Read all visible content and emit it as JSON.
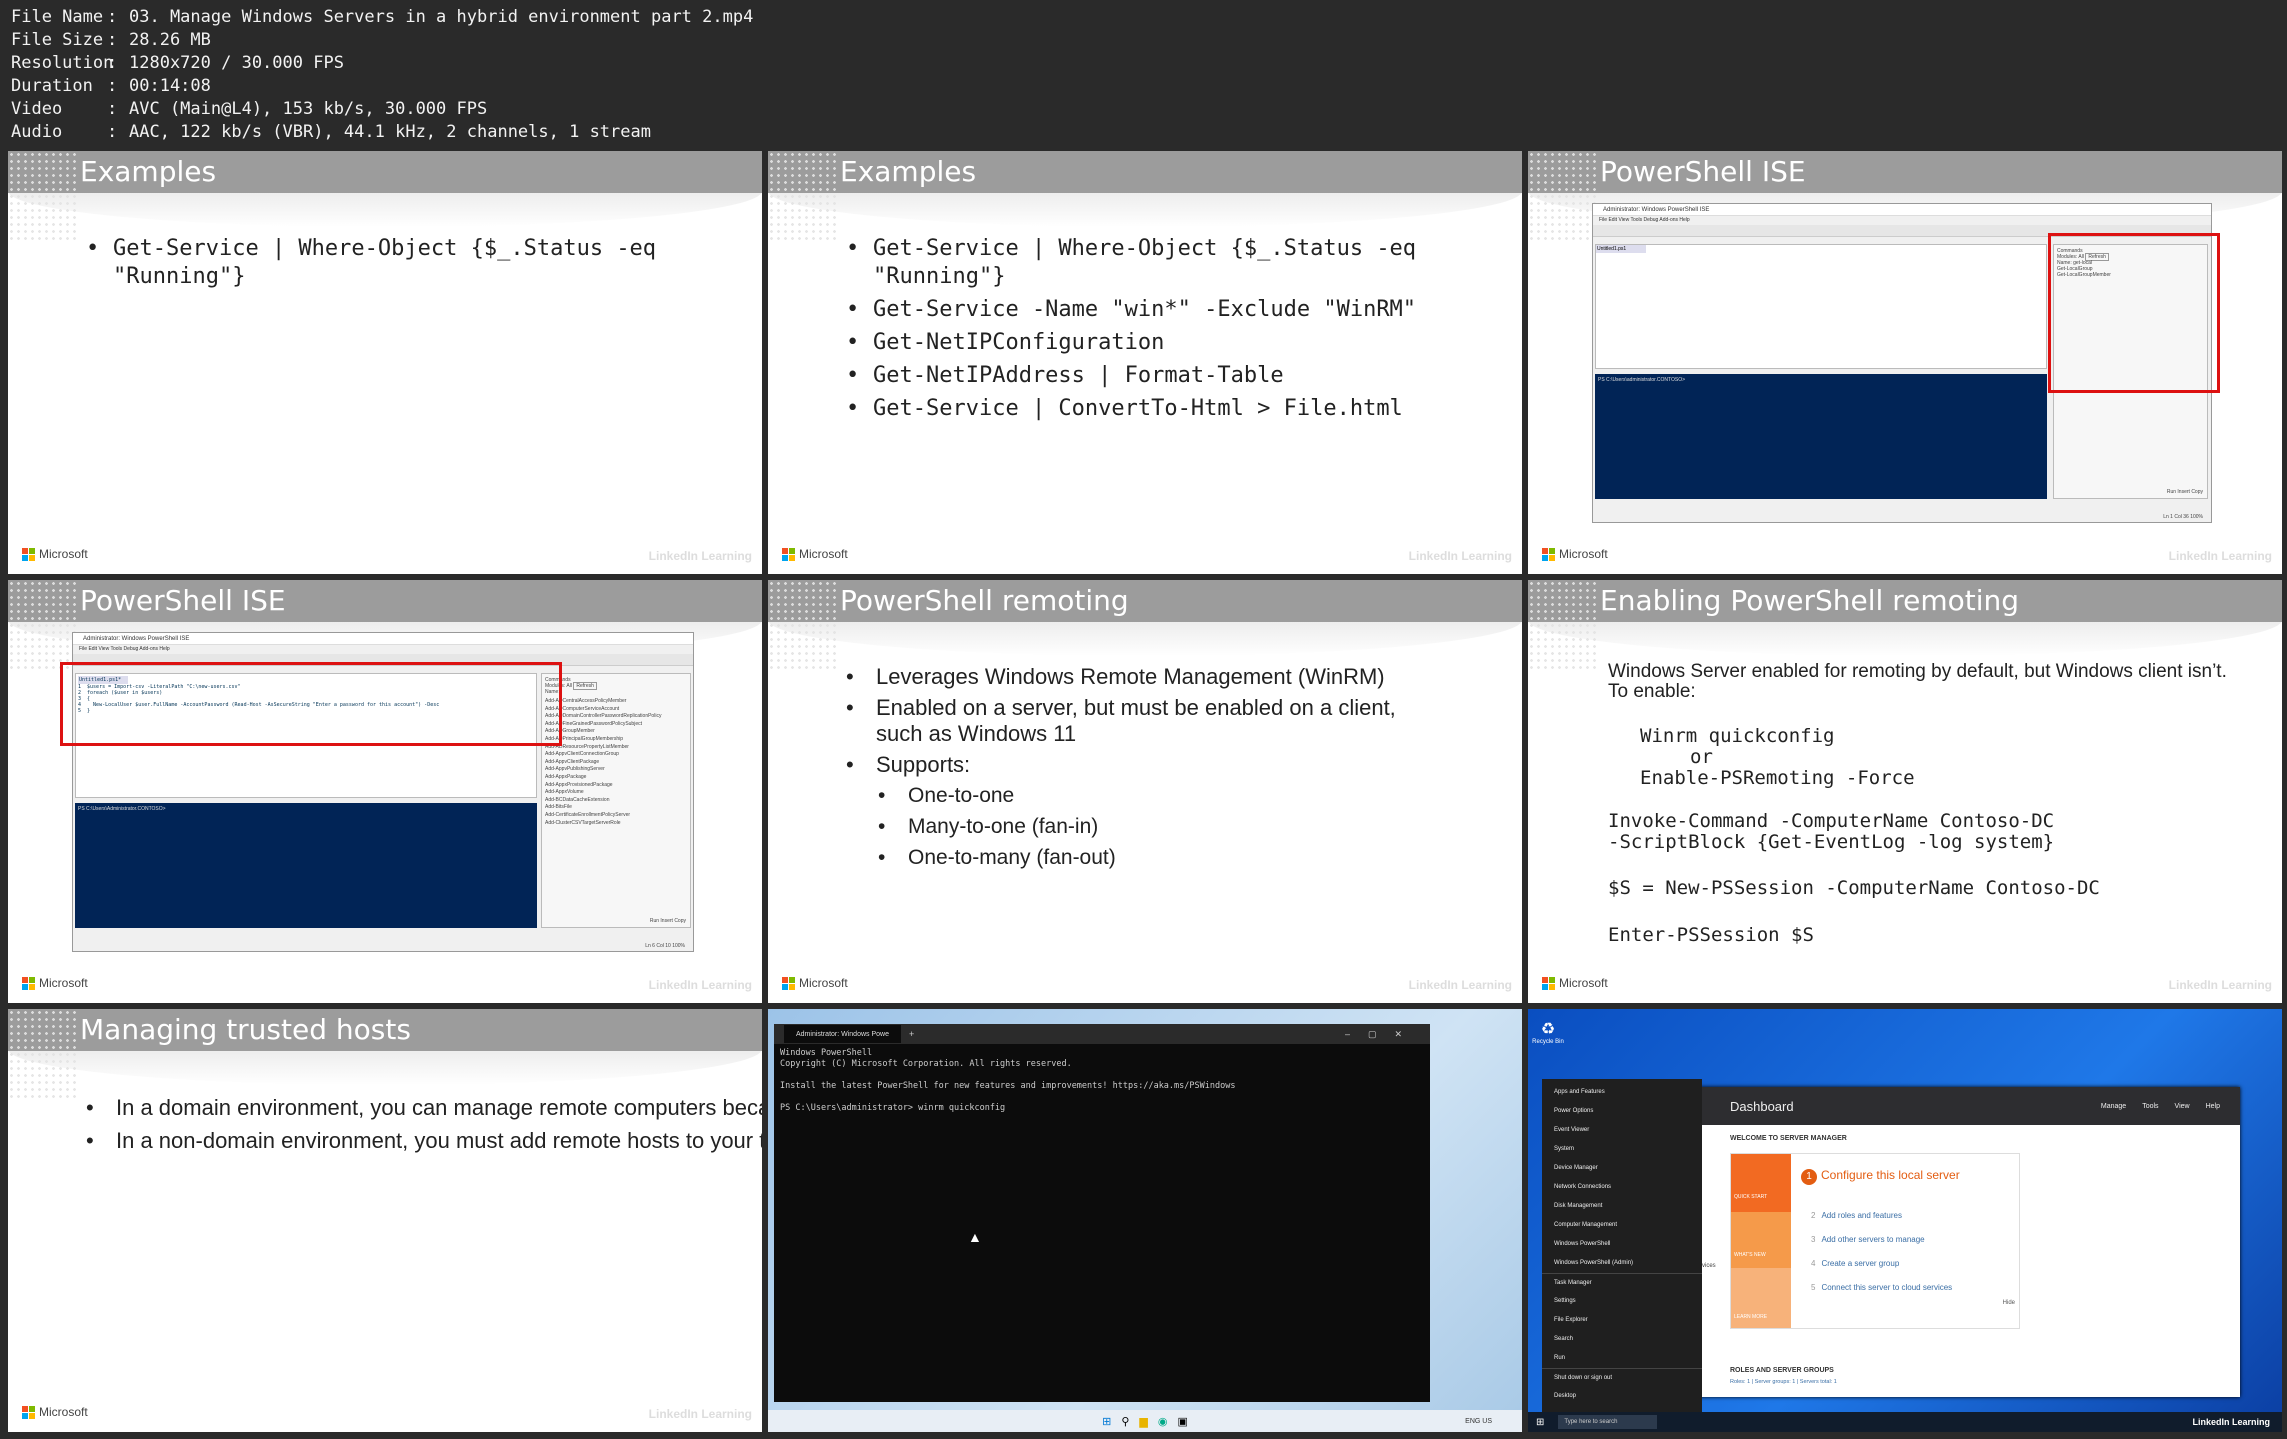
{
  "file_info": [
    {
      "key": "File Name",
      "value": "03. Manage Windows Servers in a hybrid environment part 2.mp4"
    },
    {
      "key": "File Size",
      "value": "28.26 MB"
    },
    {
      "key": "Resolution",
      "value": "1280x720 / 30.000 FPS"
    },
    {
      "key": "Duration",
      "value": "00:14:08"
    },
    {
      "key": "Video",
      "value": "AVC (Main@L4), 153 kb/s, 30.000 FPS"
    },
    {
      "key": "Audio",
      "value": "AAC, 122 kb/s (VBR), 44.1 kHz, 2 channels, 1 stream"
    }
  ],
  "brand": "Microsoft",
  "watermark": "LinkedIn Learning",
  "slides": {
    "s1": {
      "title": "Examples",
      "items": [
        "Get-Service | Where-Object {$_.Status -eq\n\"Running\"}"
      ]
    },
    "s2": {
      "title": "Examples",
      "items": [
        "Get-Service | Where-Object {$_.Status -eq\n\"Running\"}",
        "Get-Service -Name \"win*\" -Exclude \"WinRM\"",
        "Get-NetIPConfiguration",
        "Get-NetIPAddress | Format-Table",
        "Get-Service | ConvertTo-Html > File.html"
      ]
    },
    "s3": {
      "title": "PowerShell ISE",
      "window_title": "Administrator: Windows PowerShell ISE",
      "menu": "File  Edit  View  Tools  Debug  Add-ons  Help",
      "tab": "Untitled1.ps1",
      "prompt": "PS C:\\Users\\administrator.CONTOSO>",
      "commands_tab": "Commands",
      "modules_label": "Modules:",
      "modules_value": "All",
      "name_label": "Name:",
      "name_value": "get-local",
      "refresh": "Refresh",
      "cmd1": "Get-LocalGroup",
      "cmd2": "Get-LocalGroupMember",
      "status": "Ln 1  Col 36",
      "zoom": "100%",
      "buttons": [
        "Run",
        "Insert",
        "Copy"
      ]
    },
    "s4": {
      "title": "PowerShell ISE",
      "window_title": "Administrator: Windows PowerShell ISE",
      "menu": "File  Edit  View  Tools  Debug  Add-ons  Help",
      "tab": "Untitled1.ps1*",
      "code": [
        "1  $users = Import-csv -LiteralPath \"C:\\new-users.csv\"",
        "2  foreach ($user in $users)",
        "3  {",
        "4    New-LocalUser $user.FullName -AccountPassword (Read-Host -AsSecureString \"Enter a password for this account\") -Desc",
        "5  }"
      ],
      "prompt": "PS C:\\Users\\Administrator.CONTOSO>",
      "commands_tab": "Commands",
      "modules_label": "Modules:",
      "modules_value": "All",
      "name_label": "Name:",
      "refresh": "Refresh",
      "cmd_list": [
        "Add-ADCentralAccessPolicyMember",
        "Add-ADComputerServiceAccount",
        "Add-ADDomainControllerPasswordReplicationPolicy",
        "Add-ADFineGrainedPasswordPolicySubject",
        "Add-ADGroupMember",
        "Add-ADPrincipalGroupMembership",
        "Add-ADResourcePropertyListMember",
        "Add-AppvClientConnectionGroup",
        "Add-AppvClientPackage",
        "Add-AppvPublishingServer",
        "Add-AppxPackage",
        "Add-AppxProvisionedPackage",
        "Add-AppxVolume",
        "Add-BCDataCacheExtension",
        "Add-BitsFile",
        "Add-CertificateEnrollmentPolicyServer",
        "Add-ClusterCSVTargetServerRole"
      ],
      "status": "Ln 6  Col 10",
      "zoom": "100%",
      "buttons": [
        "Run",
        "Insert",
        "Copy"
      ]
    },
    "s5": {
      "title": "PowerShell remoting",
      "items": [
        {
          "text": "Leverages Windows Remote Management (WinRM)",
          "sub": false
        },
        {
          "text": "Enabled on a server, but must be enabled on a client, such as Windows 11",
          "sub": false
        },
        {
          "text": "Supports:",
          "sub": false
        },
        {
          "text": "One-to-one",
          "sub": true
        },
        {
          "text": "Many-to-one (fan-in)",
          "sub": true
        },
        {
          "text": "One-to-many (fan-out)",
          "sub": true
        }
      ]
    },
    "s6": {
      "title": "Enabling PowerShell remoting",
      "intro": "Windows Server enabled for remoting by default, but Windows client isn’t. To enable:",
      "cmd1": "Winrm quickconfig",
      "or": "or",
      "cmd2": "Enable-PSRemoting -Force",
      "invoke1": "Invoke-Command -ComputerName Contoso-DC",
      "invoke2": "-ScriptBlock {Get-EventLog -log system}",
      "session": "$S = New-PSSession -ComputerName Contoso-DC",
      "enter": "Enter-PSSession $S"
    },
    "s7": {
      "title": "Managing trusted hosts",
      "items": [
        "In a domain environment, you can manage remote computers because you can authenticate using Kerberos.",
        "In a non-domain environment, you must add remote hosts to your trusted hosts list:"
      ]
    },
    "s8": {
      "tab": "Administrator: Windows Powe",
      "lines": [
        "Windows PowerShell",
        "Copyright (C) Microsoft Corporation. All rights reserved.",
        "",
        "Install the latest PowerShell for new features and improvements! https://aka.ms/PSWindows",
        "",
        "PS C:\\Users\\administrator> winrm quickconfig"
      ],
      "tray": "ENG US"
    },
    "s9": {
      "recycle": "Recycle Bin",
      "menu_items": [
        "Apps and Features",
        "Power Options",
        "Event Viewer",
        "System",
        "Device Manager",
        "Network Connections",
        "Disk Management",
        "Computer Management",
        "Windows PowerShell",
        "Windows PowerShell (Admin)",
        "Task Manager",
        "Settings",
        "File Explorer",
        "Search",
        "Run",
        "Shut down or sign out",
        "Desktop"
      ],
      "dashboard": "Dashboard",
      "sm_menu": [
        "Manage",
        "Tools",
        "View",
        "Help"
      ],
      "welcome": "WELCOME TO SERVER MANAGER",
      "configure": "Configure this local server",
      "quick_start": "QUICK START",
      "whats_new": "WHAT'S NEW",
      "learn_more": "LEARN MORE",
      "steps": [
        "Add roles and features",
        "Add other servers to manage",
        "Create a server group",
        "Connect this server to cloud services"
      ],
      "hide": "Hide",
      "roles": "ROLES AND SERVER GROUPS",
      "roles_sub": "Roles: 1  |  Server groups: 1  |  Servers total: 1",
      "services": "rvices",
      "search": "Type here to search"
    }
  }
}
